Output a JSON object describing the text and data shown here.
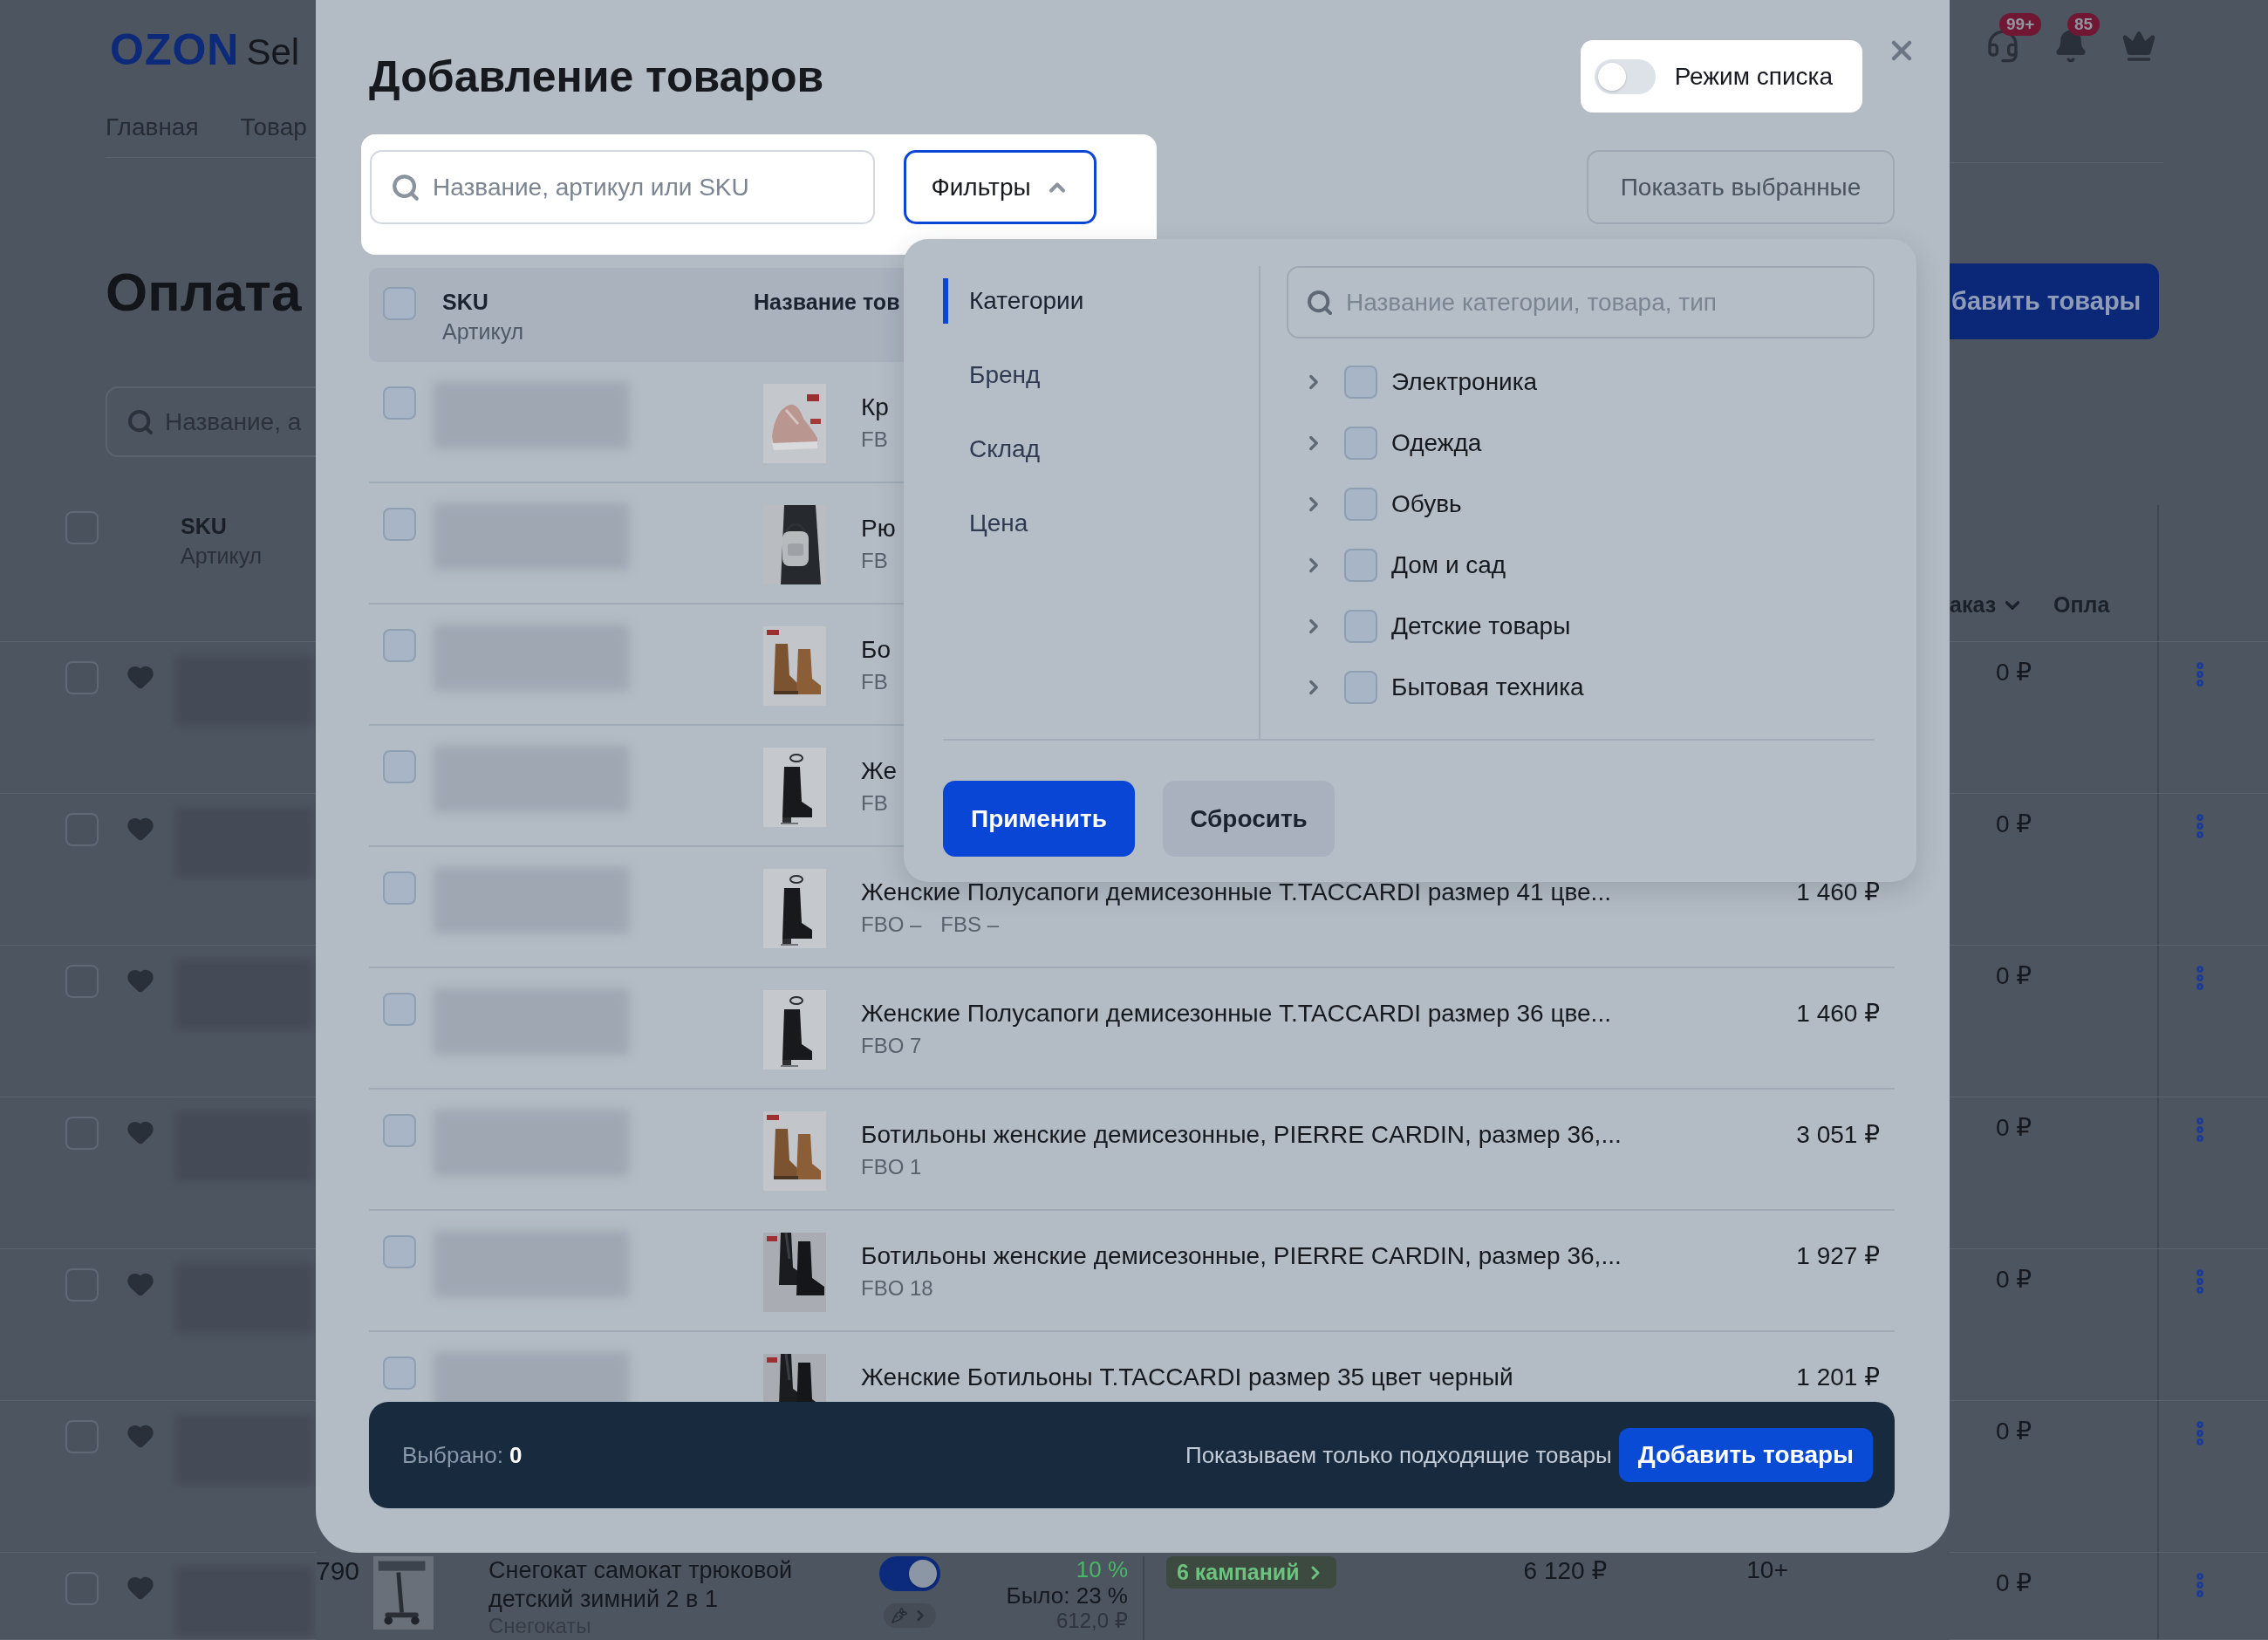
{
  "background": {
    "logo": "OZON",
    "logo_cut": "Sel",
    "nav": [
      "Главная",
      "Товар"
    ],
    "title": "Оплата",
    "search": {
      "placeholder": "Название, а"
    },
    "add_button": "бавить товары",
    "badges": [
      "99+",
      "85"
    ],
    "table": {
      "all_checked": false,
      "sku": "SKU",
      "article": "Артикул",
      "column_order": "аказ",
      "column_payment": "Опла"
    },
    "rows": [
      {
        "checked": false,
        "payment": "0 ₽"
      },
      {
        "checked": false,
        "payment": "0 ₽"
      },
      {
        "checked": false,
        "payment": "0 ₽"
      },
      {
        "checked": false,
        "payment": "0 ₽"
      },
      {
        "checked": false,
        "payment": "0 ₽"
      },
      {
        "checked": false,
        "payment": "0 ₽"
      },
      {
        "checked": false,
        "payment": "0 ₽",
        "code": "790",
        "name": "Снегокат самокат трюковой детский зимний 2 в 1",
        "category": "Снегокаты",
        "promo_on": true,
        "discount": "10 %",
        "was": "Было: 23 %",
        "was_price": "612,0 ₽",
        "campaigns": "6 кампаний",
        "price": "6 120 ₽",
        "stock": "10+"
      }
    ]
  },
  "modal": {
    "title": "Добавление товаров",
    "list_mode": {
      "label": "Режим списка",
      "on": false
    },
    "search": {
      "placeholder": "Название, артикул или SKU"
    },
    "filters_button": {
      "label": "Фильтры",
      "expanded": true
    },
    "show_selected_button": "Показать выбранные",
    "table": {
      "all_checked": false,
      "sku": "SKU",
      "article": "Артикул",
      "name": "Название тов",
      "rows": [
        {
          "checked": false,
          "name": "Кр",
          "stock": [
            "FB"
          ]
        },
        {
          "checked": false,
          "name": "Рю",
          "stock": [
            "FB"
          ]
        },
        {
          "checked": false,
          "name": "Бо",
          "stock": [
            "FB"
          ]
        },
        {
          "checked": false,
          "name": "Же",
          "stock": [
            "FB"
          ]
        },
        {
          "checked": false,
          "name": "Женские Полусапоги демисезонные T.TACCARDI размер 41 цве...",
          "stock": [
            "FBO –",
            "FBS –"
          ],
          "price": "1 460 ₽"
        },
        {
          "checked": false,
          "name": "Женские Полусапоги демисезонные T.TACCARDI размер 36 цве...",
          "stock": [
            "FBO 7"
          ],
          "price": "1 460 ₽"
        },
        {
          "checked": false,
          "name": "Ботильоны женские демисезонные, PIERRE CARDIN, размер 36,...",
          "stock": [
            "FBO 1"
          ],
          "price": "3 051 ₽"
        },
        {
          "checked": false,
          "name": "Ботильоны женские демисезонные, PIERRE CARDIN, размер 36,...",
          "stock": [
            "FBO 18"
          ],
          "price": "1 927 ₽"
        },
        {
          "checked": false,
          "name": "Женские Ботильоны T.TACCARDI размер 35 цвет черный",
          "price": "1 201 ₽"
        }
      ]
    },
    "filter_panel": {
      "sections": [
        {
          "label": "Категории",
          "selected": true
        },
        {
          "label": "Бренд",
          "selected": false
        },
        {
          "label": "Склад",
          "selected": false
        },
        {
          "label": "Цена",
          "selected": false
        }
      ],
      "search": {
        "placeholder": "Название категории, товара, тип"
      },
      "categories": [
        {
          "label": "Электроника",
          "checked": false,
          "expanded": false
        },
        {
          "label": "Одежда",
          "checked": false,
          "expanded": false
        },
        {
          "label": "Обувь",
          "checked": false,
          "expanded": false
        },
        {
          "label": "Дом и сад",
          "checked": false,
          "expanded": false
        },
        {
          "label": "Детские товары",
          "checked": false,
          "expanded": false
        },
        {
          "label": "Бытовая техника",
          "checked": false,
          "expanded": false
        }
      ],
      "apply_button": "Применить",
      "reset_button": "Сбросить"
    },
    "footer": {
      "selected": "Выбрано: **0**",
      "hint": "Показываем только подходящие товары",
      "add_button": "Добавить товары"
    }
  }
}
